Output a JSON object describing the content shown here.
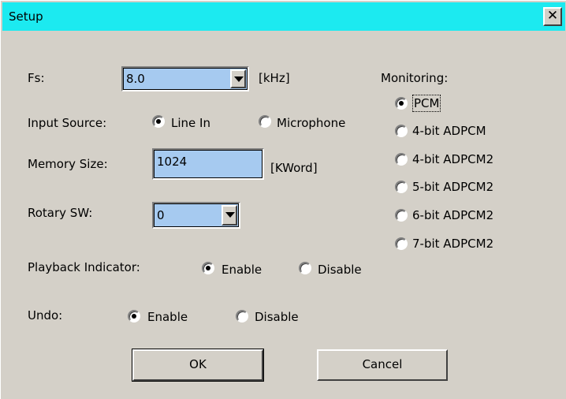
{
  "window": {
    "title": "Setup",
    "close_glyph": "✕"
  },
  "fs": {
    "label": "Fs:",
    "value": "8.0",
    "unit": "[kHz]"
  },
  "input_source": {
    "label": "Input Source:",
    "options": [
      "Line In",
      "Microphone"
    ],
    "selected": "Line In"
  },
  "memory": {
    "label": "Memory Size:",
    "value": "1024",
    "unit": "[KWord]"
  },
  "rotary": {
    "label": "Rotary SW:",
    "value": "0"
  },
  "playback": {
    "label": "Playback Indicator:",
    "options": [
      "Enable",
      "Disable"
    ],
    "selected": "Enable"
  },
  "undo": {
    "label": "Undo:",
    "options": [
      "Enable",
      "Disable"
    ],
    "selected": "Enable"
  },
  "monitoring": {
    "label": "Monitoring:",
    "options": [
      "PCM",
      "4-bit ADPCM",
      "4-bit ADPCM2",
      "5-bit ADPCM2",
      "6-bit ADPCM2",
      "7-bit ADPCM2"
    ],
    "selected": "PCM"
  },
  "buttons": {
    "ok": "OK",
    "cancel": "Cancel"
  },
  "colors": {
    "titlebar": "#1ceaf0",
    "field_bg": "#a6caf0",
    "dialog_bg": "#d4d0c8"
  }
}
